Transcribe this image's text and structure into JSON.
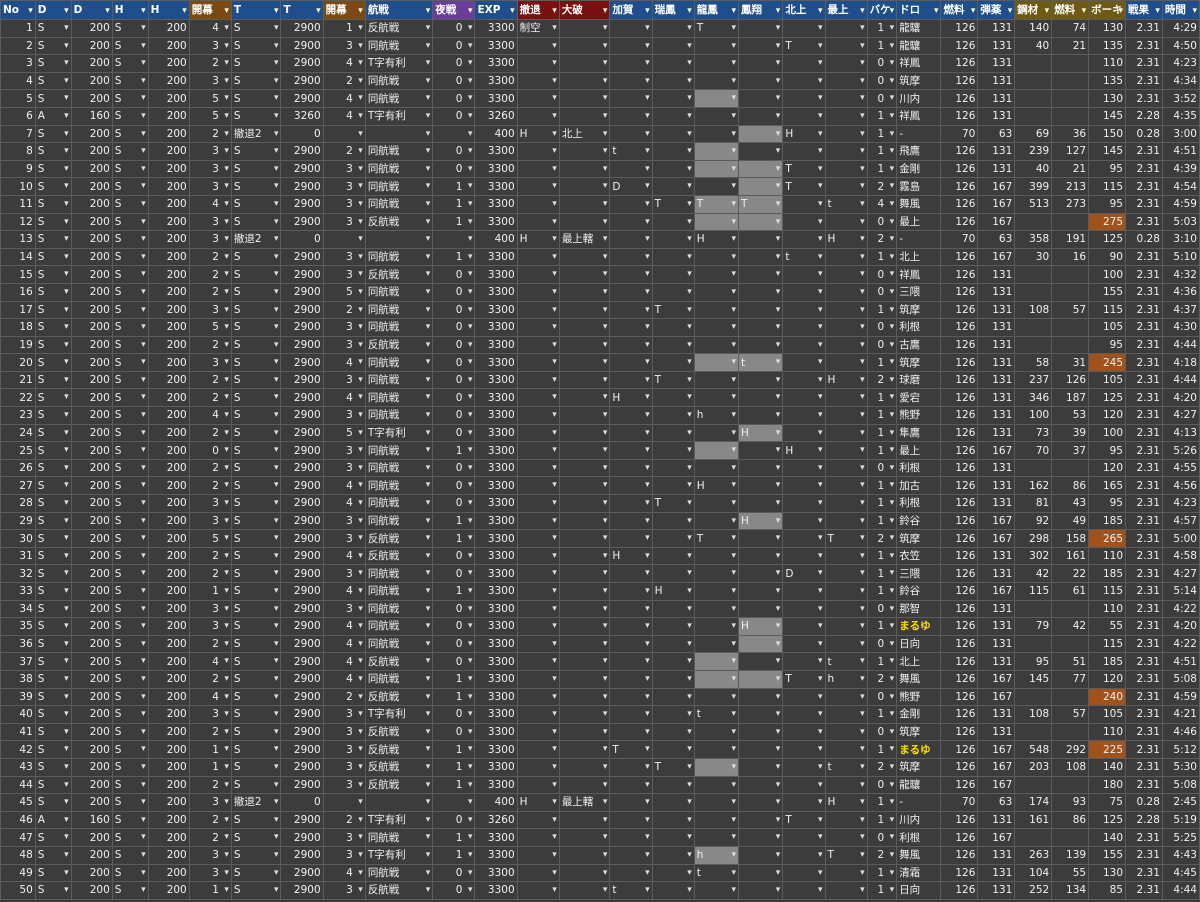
{
  "headers": [
    "No",
    "D",
    "D",
    "H",
    "H",
    "開幕",
    "T",
    "T",
    "開幕",
    "航戦",
    "夜戦",
    "EXP",
    "撤退",
    "大破",
    "加賀",
    "瑞鳳",
    "龍鳳",
    "鳳翔",
    "北上",
    "最上",
    "バケ",
    "ドロ",
    "燃料",
    "弾薬",
    "鋼材",
    "燃料",
    "ボーキ",
    "戦果",
    "時間"
  ],
  "rows": [
    [
      "1",
      "S",
      "200",
      "S",
      "200",
      "4",
      "S",
      "2900",
      "1",
      "反航戦",
      "0",
      "3300",
      "制空",
      "",
      "",
      "",
      "T",
      "",
      "",
      "",
      "1",
      "龍驤",
      "126",
      "131",
      "140",
      "74",
      "130",
      "2.31",
      "4:29"
    ],
    [
      "2",
      "S",
      "200",
      "S",
      "200",
      "3",
      "S",
      "2900",
      "3",
      "同航戦",
      "0",
      "3300",
      "",
      "",
      "",
      "",
      "",
      "",
      "T",
      "",
      "1",
      "龍驤",
      "126",
      "131",
      "40",
      "21",
      "135",
      "2.31",
      "4:50"
    ],
    [
      "3",
      "S",
      "200",
      "S",
      "200",
      "2",
      "S",
      "2900",
      "4",
      "T字有利",
      "0",
      "3300",
      "",
      "",
      "",
      "",
      "",
      "",
      "",
      "",
      "0",
      "祥鳳",
      "126",
      "131",
      "",
      "",
      "110",
      "2.31",
      "4:23"
    ],
    [
      "4",
      "S",
      "200",
      "S",
      "200",
      "3",
      "S",
      "2900",
      "2",
      "同航戦",
      "0",
      "3300",
      "",
      "",
      "",
      "",
      "",
      "",
      "",
      "",
      "0",
      "筑摩",
      "126",
      "131",
      "",
      "",
      "135",
      "2.31",
      "4:34"
    ],
    [
      "5",
      "S",
      "200",
      "S",
      "200",
      "5",
      "S",
      "2900",
      "4",
      "同航戦",
      "0",
      "3300",
      "",
      "",
      "",
      "",
      "",
      "",
      "",
      "",
      "0",
      "川内",
      "126",
      "131",
      "",
      "",
      "130",
      "2.31",
      "3:52"
    ],
    [
      "6",
      "A",
      "160",
      "S",
      "200",
      "5",
      "S",
      "3260",
      "4",
      "T字有利",
      "0",
      "3260",
      "",
      "",
      "",
      "",
      "",
      "",
      "",
      "",
      "1",
      "祥鳳",
      "126",
      "131",
      "",
      "",
      "145",
      "2.28",
      "4:35"
    ],
    [
      "7",
      "S",
      "200",
      "S",
      "200",
      "2",
      "撤退2",
      "0",
      "",
      "",
      "",
      "400",
      "H",
      "北上",
      "",
      "",
      "",
      "",
      "H",
      "",
      "1",
      "-",
      "70",
      "63",
      "69",
      "36",
      "150",
      "0.28",
      "3:00"
    ],
    [
      "8",
      "S",
      "200",
      "S",
      "200",
      "3",
      "S",
      "2900",
      "2",
      "同航戦",
      "0",
      "3300",
      "",
      "",
      "t",
      "",
      "",
      "",
      "",
      "",
      "1",
      "飛鷹",
      "126",
      "131",
      "239",
      "127",
      "145",
      "2.31",
      "4:51"
    ],
    [
      "9",
      "S",
      "200",
      "S",
      "200",
      "3",
      "S",
      "2900",
      "3",
      "同航戦",
      "0",
      "3300",
      "",
      "",
      "",
      "",
      "",
      "",
      "T",
      "",
      "1",
      "金剛",
      "126",
      "131",
      "40",
      "21",
      "95",
      "2.31",
      "4:39"
    ],
    [
      "10",
      "S",
      "200",
      "S",
      "200",
      "3",
      "S",
      "2900",
      "3",
      "同航戦",
      "1",
      "3300",
      "",
      "",
      "D",
      "",
      "",
      "",
      "T",
      "",
      "2",
      "霧島",
      "126",
      "167",
      "399",
      "213",
      "115",
      "2.31",
      "4:54"
    ],
    [
      "11",
      "S",
      "200",
      "S",
      "200",
      "4",
      "S",
      "2900",
      "3",
      "同航戦",
      "1",
      "3300",
      "",
      "",
      "",
      "T",
      "T",
      "T",
      "",
      "t",
      "4",
      "舞風",
      "126",
      "167",
      "513",
      "273",
      "95",
      "2.31",
      "4:59"
    ],
    [
      "12",
      "S",
      "200",
      "S",
      "200",
      "3",
      "S",
      "2900",
      "3",
      "反航戦",
      "1",
      "3300",
      "",
      "",
      "",
      "",
      "",
      "",
      "",
      "",
      "0",
      "最上",
      "126",
      "167",
      "",
      "",
      "275",
      "2.31",
      "5:03"
    ],
    [
      "13",
      "S",
      "200",
      "S",
      "200",
      "3",
      "撤退2",
      "0",
      "",
      "",
      "",
      "400",
      "H",
      "最上轄",
      "",
      "",
      "H",
      "",
      "",
      "H",
      "2",
      "-",
      "70",
      "63",
      "358",
      "191",
      "125",
      "0.28",
      "3:10"
    ],
    [
      "14",
      "S",
      "200",
      "S",
      "200",
      "2",
      "S",
      "2900",
      "3",
      "同航戦",
      "1",
      "3300",
      "",
      "",
      "",
      "",
      "",
      "",
      "t",
      "",
      "1",
      "北上",
      "126",
      "167",
      "30",
      "16",
      "90",
      "2.31",
      "5:10"
    ],
    [
      "15",
      "S",
      "200",
      "S",
      "200",
      "2",
      "S",
      "2900",
      "3",
      "反航戦",
      "0",
      "3300",
      "",
      "",
      "",
      "",
      "",
      "",
      "",
      "",
      "0",
      "祥鳳",
      "126",
      "131",
      "",
      "",
      "100",
      "2.31",
      "4:32"
    ],
    [
      "16",
      "S",
      "200",
      "S",
      "200",
      "2",
      "S",
      "2900",
      "5",
      "同航戦",
      "0",
      "3300",
      "",
      "",
      "",
      "",
      "",
      "",
      "",
      "",
      "0",
      "三隈",
      "126",
      "131",
      "",
      "",
      "155",
      "2.31",
      "4:36"
    ],
    [
      "17",
      "S",
      "200",
      "S",
      "200",
      "3",
      "S",
      "2900",
      "2",
      "同航戦",
      "0",
      "3300",
      "",
      "",
      "",
      "T",
      "",
      "",
      "",
      "",
      "1",
      "筑摩",
      "126",
      "131",
      "108",
      "57",
      "115",
      "2.31",
      "4:37"
    ],
    [
      "18",
      "S",
      "200",
      "S",
      "200",
      "5",
      "S",
      "2900",
      "3",
      "同航戦",
      "0",
      "3300",
      "",
      "",
      "",
      "",
      "",
      "",
      "",
      "",
      "0",
      "利根",
      "126",
      "131",
      "",
      "",
      "105",
      "2.31",
      "4:30"
    ],
    [
      "19",
      "S",
      "200",
      "S",
      "200",
      "2",
      "S",
      "2900",
      "3",
      "反航戦",
      "0",
      "3300",
      "",
      "",
      "",
      "",
      "",
      "",
      "",
      "",
      "0",
      "古鷹",
      "126",
      "131",
      "",
      "",
      "95",
      "2.31",
      "4:44"
    ],
    [
      "20",
      "S",
      "200",
      "S",
      "200",
      "3",
      "S",
      "2900",
      "4",
      "同航戦",
      "0",
      "3300",
      "",
      "",
      "",
      "",
      "",
      "t",
      "",
      "",
      "1",
      "筑摩",
      "126",
      "131",
      "58",
      "31",
      "245",
      "2.31",
      "4:18"
    ],
    [
      "21",
      "S",
      "200",
      "S",
      "200",
      "2",
      "S",
      "2900",
      "3",
      "同航戦",
      "0",
      "3300",
      "",
      "",
      "",
      "T",
      "",
      "",
      "",
      "H",
      "2",
      "球磨",
      "126",
      "131",
      "237",
      "126",
      "105",
      "2.31",
      "4:44"
    ],
    [
      "22",
      "S",
      "200",
      "S",
      "200",
      "2",
      "S",
      "2900",
      "4",
      "同航戦",
      "0",
      "3300",
      "",
      "",
      "H",
      "",
      "",
      "",
      "",
      "",
      "1",
      "愛宕",
      "126",
      "131",
      "346",
      "187",
      "125",
      "2.31",
      "4:20"
    ],
    [
      "23",
      "S",
      "200",
      "S",
      "200",
      "4",
      "S",
      "2900",
      "3",
      "同航戦",
      "0",
      "3300",
      "",
      "",
      "",
      "",
      "h",
      "",
      "",
      "",
      "1",
      "熊野",
      "126",
      "131",
      "100",
      "53",
      "120",
      "2.31",
      "4:27"
    ],
    [
      "24",
      "S",
      "200",
      "S",
      "200",
      "2",
      "S",
      "2900",
      "5",
      "T字有利",
      "0",
      "3300",
      "",
      "",
      "",
      "",
      "",
      "H",
      "",
      "",
      "1",
      "隼鷹",
      "126",
      "131",
      "73",
      "39",
      "100",
      "2.31",
      "4:13"
    ],
    [
      "25",
      "S",
      "200",
      "S",
      "200",
      "0",
      "S",
      "2900",
      "3",
      "同航戦",
      "1",
      "3300",
      "",
      "",
      "",
      "",
      "",
      "",
      "H",
      "",
      "1",
      "最上",
      "126",
      "167",
      "70",
      "37",
      "95",
      "2.31",
      "5:26"
    ],
    [
      "26",
      "S",
      "200",
      "S",
      "200",
      "2",
      "S",
      "2900",
      "3",
      "同航戦",
      "0",
      "3300",
      "",
      "",
      "",
      "",
      "",
      "",
      "",
      "",
      "0",
      "利根",
      "126",
      "131",
      "",
      "",
      "120",
      "2.31",
      "4:55"
    ],
    [
      "27",
      "S",
      "200",
      "S",
      "200",
      "2",
      "S",
      "2900",
      "4",
      "同航戦",
      "0",
      "3300",
      "",
      "",
      "",
      "",
      "H",
      "",
      "",
      "",
      "1",
      "加古",
      "126",
      "131",
      "162",
      "86",
      "165",
      "2.31",
      "4:56"
    ],
    [
      "28",
      "S",
      "200",
      "S",
      "200",
      "3",
      "S",
      "2900",
      "4",
      "同航戦",
      "0",
      "3300",
      "",
      "",
      "",
      "T",
      "",
      "",
      "",
      "",
      "1",
      "利根",
      "126",
      "131",
      "81",
      "43",
      "95",
      "2.31",
      "4:23"
    ],
    [
      "29",
      "S",
      "200",
      "S",
      "200",
      "3",
      "S",
      "2900",
      "3",
      "同航戦",
      "1",
      "3300",
      "",
      "",
      "",
      "",
      "",
      "H",
      "",
      "",
      "1",
      "鈴谷",
      "126",
      "167",
      "92",
      "49",
      "185",
      "2.31",
      "4:57"
    ],
    [
      "30",
      "S",
      "200",
      "S",
      "200",
      "5",
      "S",
      "2900",
      "3",
      "反航戦",
      "1",
      "3300",
      "",
      "",
      "",
      "",
      "T",
      "",
      "",
      "T",
      "2",
      "筑摩",
      "126",
      "167",
      "298",
      "158",
      "265",
      "2.31",
      "5:00"
    ],
    [
      "31",
      "S",
      "200",
      "S",
      "200",
      "2",
      "S",
      "2900",
      "4",
      "反航戦",
      "0",
      "3300",
      "",
      "",
      "H",
      "",
      "",
      "",
      "",
      "",
      "1",
      "衣笠",
      "126",
      "131",
      "302",
      "161",
      "110",
      "2.31",
      "4:58"
    ],
    [
      "32",
      "S",
      "200",
      "S",
      "200",
      "2",
      "S",
      "2900",
      "3",
      "同航戦",
      "0",
      "3300",
      "",
      "",
      "",
      "",
      "",
      "",
      "D",
      "",
      "1",
      "三隈",
      "126",
      "131",
      "42",
      "22",
      "185",
      "2.31",
      "4:27"
    ],
    [
      "33",
      "S",
      "200",
      "S",
      "200",
      "1",
      "S",
      "2900",
      "4",
      "同航戦",
      "1",
      "3300",
      "",
      "",
      "",
      "H",
      "",
      "",
      "",
      "",
      "1",
      "鈴谷",
      "126",
      "167",
      "115",
      "61",
      "115",
      "2.31",
      "5:14"
    ],
    [
      "34",
      "S",
      "200",
      "S",
      "200",
      "3",
      "S",
      "2900",
      "3",
      "同航戦",
      "0",
      "3300",
      "",
      "",
      "",
      "",
      "",
      "",
      "",
      "",
      "0",
      "那智",
      "126",
      "131",
      "",
      "",
      "110",
      "2.31",
      "4:22"
    ],
    [
      "35",
      "S",
      "200",
      "S",
      "200",
      "3",
      "S",
      "2900",
      "4",
      "同航戦",
      "0",
      "3300",
      "",
      "",
      "",
      "",
      "",
      "H",
      "",
      "",
      "1",
      "まるゆ",
      "126",
      "131",
      "79",
      "42",
      "55",
      "2.31",
      "4:20"
    ],
    [
      "36",
      "S",
      "200",
      "S",
      "200",
      "2",
      "S",
      "2900",
      "4",
      "同航戦",
      "0",
      "3300",
      "",
      "",
      "",
      "",
      "",
      "",
      "",
      "",
      "0",
      "日向",
      "126",
      "131",
      "",
      "",
      "115",
      "2.31",
      "4:22"
    ],
    [
      "37",
      "S",
      "200",
      "S",
      "200",
      "4",
      "S",
      "2900",
      "4",
      "反航戦",
      "0",
      "3300",
      "",
      "",
      "",
      "",
      "",
      "",
      "",
      "t",
      "1",
      "北上",
      "126",
      "131",
      "95",
      "51",
      "185",
      "2.31",
      "4:51"
    ],
    [
      "38",
      "S",
      "200",
      "S",
      "200",
      "2",
      "S",
      "2900",
      "4",
      "同航戦",
      "1",
      "3300",
      "",
      "",
      "",
      "",
      "",
      "",
      "T",
      "h",
      "2",
      "舞風",
      "126",
      "167",
      "145",
      "77",
      "120",
      "2.31",
      "5:08"
    ],
    [
      "39",
      "S",
      "200",
      "S",
      "200",
      "4",
      "S",
      "2900",
      "2",
      "反航戦",
      "1",
      "3300",
      "",
      "",
      "",
      "",
      "",
      "",
      "",
      "",
      "0",
      "熊野",
      "126",
      "167",
      "",
      "",
      "240",
      "2.31",
      "4:59"
    ],
    [
      "40",
      "S",
      "200",
      "S",
      "200",
      "3",
      "S",
      "2900",
      "3",
      "T字有利",
      "0",
      "3300",
      "",
      "",
      "",
      "",
      "t",
      "",
      "",
      "",
      "1",
      "金剛",
      "126",
      "131",
      "108",
      "57",
      "105",
      "2.31",
      "4:21"
    ],
    [
      "41",
      "S",
      "200",
      "S",
      "200",
      "2",
      "S",
      "2900",
      "3",
      "反航戦",
      "0",
      "3300",
      "",
      "",
      "",
      "",
      "",
      "",
      "",
      "",
      "0",
      "筑摩",
      "126",
      "131",
      "",
      "",
      "110",
      "2.31",
      "4:46"
    ],
    [
      "42",
      "S",
      "200",
      "S",
      "200",
      "1",
      "S",
      "2900",
      "3",
      "反航戦",
      "1",
      "3300",
      "",
      "",
      "T",
      "",
      "",
      "",
      "",
      "",
      "1",
      "まるゆ",
      "126",
      "167",
      "548",
      "292",
      "225",
      "2.31",
      "5:12"
    ],
    [
      "43",
      "S",
      "200",
      "S",
      "200",
      "1",
      "S",
      "2900",
      "3",
      "反航戦",
      "1",
      "3300",
      "",
      "",
      "",
      "T",
      "",
      "",
      "",
      "t",
      "2",
      "筑摩",
      "126",
      "167",
      "203",
      "108",
      "140",
      "2.31",
      "5:30"
    ],
    [
      "44",
      "S",
      "200",
      "S",
      "200",
      "2",
      "S",
      "2900",
      "3",
      "反航戦",
      "1",
      "3300",
      "",
      "",
      "",
      "",
      "",
      "",
      "",
      "",
      "0",
      "龍驤",
      "126",
      "167",
      "",
      "",
      "180",
      "2.31",
      "5:08"
    ],
    [
      "45",
      "S",
      "200",
      "S",
      "200",
      "3",
      "撤退2",
      "0",
      "",
      "",
      "",
      "400",
      "H",
      "最上轄",
      "",
      "",
      "",
      "",
      "",
      "H",
      "1",
      "-",
      "70",
      "63",
      "174",
      "93",
      "75",
      "0.28",
      "2:45"
    ],
    [
      "46",
      "A",
      "160",
      "S",
      "200",
      "2",
      "S",
      "2900",
      "2",
      "T字有利",
      "0",
      "3260",
      "",
      "",
      "",
      "",
      "",
      "",
      "T",
      "",
      "1",
      "川内",
      "126",
      "131",
      "161",
      "86",
      "125",
      "2.28",
      "5:19"
    ],
    [
      "47",
      "S",
      "200",
      "S",
      "200",
      "2",
      "S",
      "2900",
      "3",
      "同航戦",
      "1",
      "3300",
      "",
      "",
      "",
      "",
      "",
      "",
      "",
      "",
      "0",
      "利根",
      "126",
      "167",
      "",
      "",
      "140",
      "2.31",
      "5:25"
    ],
    [
      "48",
      "S",
      "200",
      "S",
      "200",
      "3",
      "S",
      "2900",
      "3",
      "T字有利",
      "1",
      "3300",
      "",
      "",
      "",
      "",
      "h",
      "",
      "",
      "T",
      "2",
      "舞風",
      "126",
      "131",
      "263",
      "139",
      "155",
      "2.31",
      "4:43"
    ],
    [
      "49",
      "S",
      "200",
      "S",
      "200",
      "3",
      "S",
      "2900",
      "4",
      "同航戦",
      "0",
      "3300",
      "",
      "",
      "",
      "",
      "t",
      "",
      "",
      "",
      "1",
      "清霜",
      "126",
      "131",
      "104",
      "55",
      "130",
      "2.31",
      "4:45"
    ],
    [
      "50",
      "S",
      "200",
      "S",
      "200",
      "1",
      "S",
      "2900",
      "3",
      "反航戦",
      "0",
      "3300",
      "",
      "",
      "t",
      "",
      "",
      "",
      "",
      "",
      "1",
      "日向",
      "126",
      "131",
      "252",
      "134",
      "85",
      "2.31",
      "4:44"
    ]
  ]
}
